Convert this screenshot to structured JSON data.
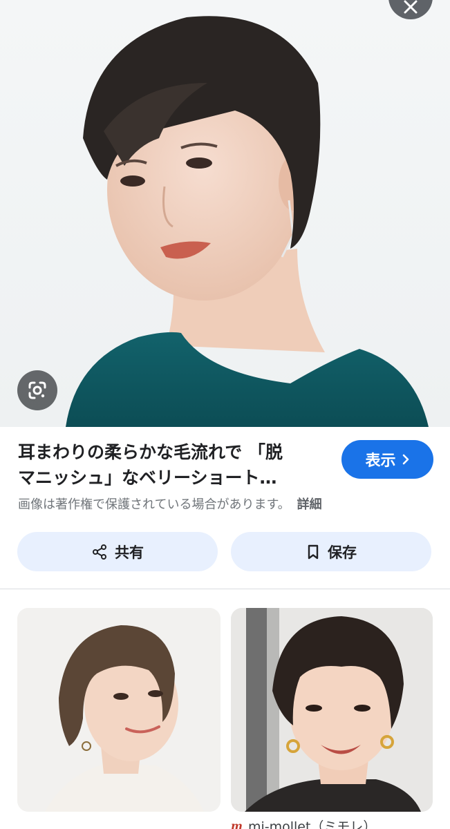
{
  "result": {
    "title_line1": "耳まわりの柔らかな毛流れで 「脱",
    "title_line2": "マニッシュ」なベリーショート…",
    "visit_label": "表示",
    "copyright_notice": "画像は著作権で保護されている場合があります。",
    "details_link": "詳細"
  },
  "actions": {
    "share_label": "共有",
    "save_label": "保存"
  },
  "related": {
    "right_source": "mi-mollet（ミモレ）",
    "right_source_logo": "m"
  },
  "icons": {
    "close": "close-icon",
    "lens": "google-lens-icon",
    "visit_arrow": "chevron-right-icon",
    "share": "share-icon",
    "save": "bookmark-icon"
  },
  "colors": {
    "accent": "#1a73e8",
    "action_bg": "#e8f0fe",
    "top_color": "#0f5a63"
  }
}
